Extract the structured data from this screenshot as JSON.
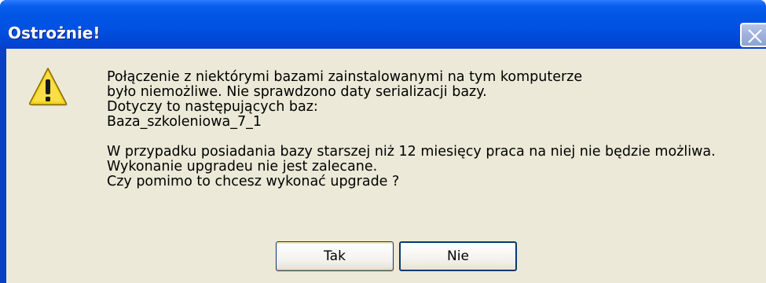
{
  "dialog": {
    "title": "Ostrożnie!",
    "icon": "warning-icon",
    "message_lines": [
      "Połączenie z niektórymi bazami zainstalowanymi na tym komputerze",
      "było niemożliwe. Nie sprawdzono daty serializacji bazy.",
      "Dotyczy to następujących baz:",
      "Baza_szkoleniowa_7_1",
      "",
      "W przypadku posiadania bazy starszej niż 12 miesięcy praca na niej nie będzie możliwa.",
      "Wykonanie upgradeu nie jest zalecane.",
      "Czy pomimo to chcesz wykonać upgrade ?"
    ],
    "buttons": {
      "yes_label": "Tak",
      "no_label": "Nie"
    }
  },
  "colors": {
    "titlebar": "#0256e5",
    "client": "#ece9d8",
    "warning_yellow": "#f8d41c"
  }
}
